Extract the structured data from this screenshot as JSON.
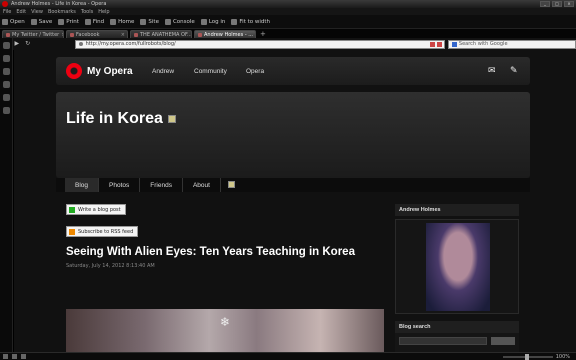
{
  "window": {
    "title": "Andrew Holmes - Life in Korea - Opera",
    "controls": [
      "_",
      "□",
      "×"
    ]
  },
  "menu": [
    "File",
    "Edit",
    "View",
    "Bookmarks",
    "Tools",
    "Help"
  ],
  "toolbar": [
    {
      "label": "Open",
      "icon": "folder-icon"
    },
    {
      "label": "Save",
      "icon": "save-icon"
    },
    {
      "label": "Print",
      "icon": "print-icon"
    },
    {
      "label": "Find",
      "icon": "find-icon"
    },
    {
      "label": "Home",
      "icon": "home-icon"
    },
    {
      "label": "Site",
      "icon": "site-icon"
    },
    {
      "label": "Console",
      "icon": "console-icon"
    },
    {
      "label": "Log in",
      "icon": "login-icon"
    },
    {
      "label": "Fit to width",
      "icon": "fit-width-icon"
    }
  ],
  "tabs": [
    {
      "label": "My Twitter / Twitter",
      "active": false
    },
    {
      "label": "Facebook",
      "active": false
    },
    {
      "label": "THE ANATHEMA OF...",
      "active": false
    },
    {
      "label": "Andrew Holmes - ...",
      "active": true
    }
  ],
  "address": {
    "url": "http://my.opera.com/fullrobots/blog/",
    "search_placeholder": "Search with Google"
  },
  "site": {
    "brand": "My Opera",
    "nav": [
      "Andrew",
      "Community",
      "Opera"
    ],
    "blog_title": "Life in Korea",
    "blog_nav": [
      {
        "label": "Blog",
        "active": true
      },
      {
        "label": "Photos",
        "active": false
      },
      {
        "label": "Friends",
        "active": false
      },
      {
        "label": "About",
        "active": false
      }
    ],
    "write_button": "Write a blog post",
    "rss_button": "Subscribe to RSS feed",
    "post_title": "Seeing With Alien Eyes: Ten Years Teaching in Korea",
    "post_date": "Saturday, July 14, 2012 8:13:40 AM",
    "sidebar_name": "Andrew Holmes",
    "blog_search_label": "Blog search"
  },
  "status": {
    "zoom": "100%"
  },
  "colors": {
    "opera_red": "#e01010",
    "background": "#111111"
  }
}
